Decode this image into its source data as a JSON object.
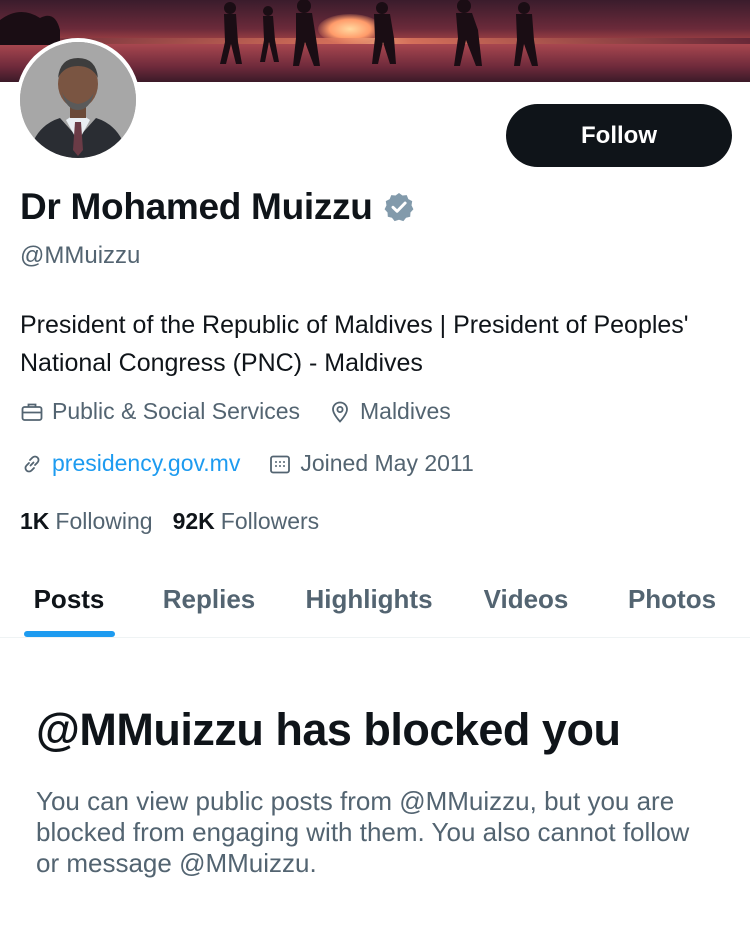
{
  "profile": {
    "display_name": "Dr Mohamed Muizzu",
    "handle": "@MMuizzu",
    "follow_label": "Follow",
    "bio": "President of the Republic of Maldives | President of Peoples' National Congress (PNC) - Maldives",
    "category": "Public & Social Services",
    "location": "Maldives",
    "website": "presidency.gov.mv",
    "joined": "Joined May 2011",
    "following_count": "1K",
    "following_label": "Following",
    "followers_count": "92K",
    "followers_label": "Followers",
    "verified_icon": "verified-badge-icon"
  },
  "tabs": [
    {
      "label": "Posts",
      "active": true
    },
    {
      "label": "Replies",
      "active": false
    },
    {
      "label": "Highlights",
      "active": false
    },
    {
      "label": "Videos",
      "active": false
    },
    {
      "label": "Photos",
      "active": false
    }
  ],
  "blocked": {
    "title": "@MMuizzu has blocked you",
    "description": "You can view public posts from @MMuizzu, but you are blocked from engaging with them. You also cannot follow or message @MMuizzu."
  },
  "colors": {
    "accent": "#1d9bf0",
    "text_primary": "#0f1419",
    "text_secondary": "#536471",
    "button_bg": "#0f1419"
  }
}
